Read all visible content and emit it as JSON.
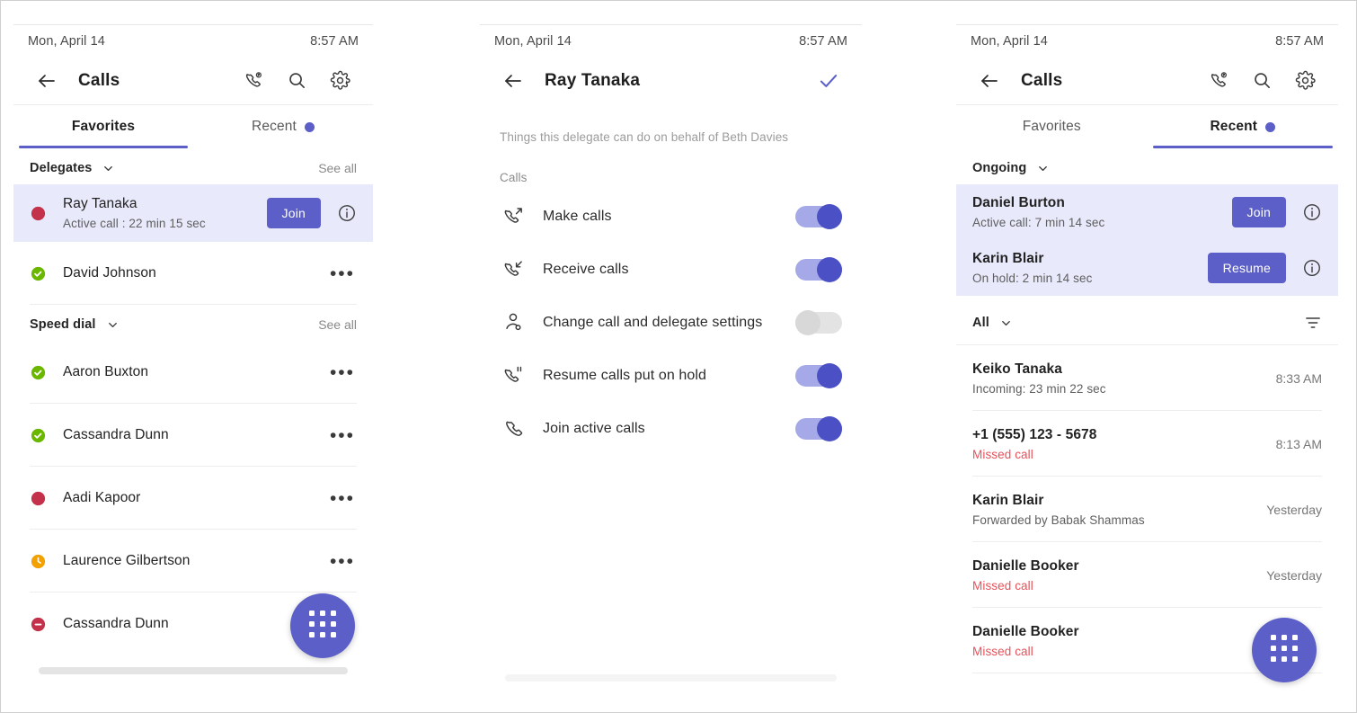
{
  "theme": {
    "accent": "#5b5fc7",
    "accent_dark": "#4b50c4",
    "missed_red": "#e8515a",
    "highlight_bg": "#e8eafc",
    "available_green": "#6bb700",
    "busy_red": "#c4314b",
    "away_orange": "#f2a101"
  },
  "panel1": {
    "status": {
      "date": "Mon, April 14",
      "time": "8:57 AM"
    },
    "appbar": {
      "title": "Calls",
      "back_icon": "arrow-left-icon",
      "actions": [
        "call-park-icon",
        "search-icon",
        "gear-icon"
      ]
    },
    "tabs": [
      {
        "label": "Favorites",
        "active": true,
        "dot": false
      },
      {
        "label": "Recent",
        "active": false,
        "dot": true
      }
    ],
    "sections": [
      {
        "label": "Delegates",
        "action": "See all",
        "rows": [
          {
            "name": "Ray Tanaka",
            "sub": "Active call : 22 min 15 sec",
            "presence": "busy",
            "highlight": true,
            "button": "Join",
            "info": true
          },
          {
            "name": "David Johnson",
            "sub": "",
            "presence": "available",
            "highlight": false,
            "more": true
          }
        ]
      },
      {
        "label": "Speed dial",
        "action": "See all",
        "rows": [
          {
            "name": "Aaron Buxton",
            "sub": "",
            "presence": "available",
            "more": true
          },
          {
            "name": "Cassandra Dunn",
            "sub": "",
            "presence": "available",
            "more": true
          },
          {
            "name": "Aadi Kapoor",
            "sub": "",
            "presence": "busy",
            "more": true
          },
          {
            "name": "Laurence Gilbertson",
            "sub": "",
            "presence": "away",
            "more": true
          },
          {
            "name": "Cassandra Dunn",
            "sub": "",
            "presence": "dnd",
            "more": false
          }
        ]
      }
    ],
    "fab": "dialpad-icon"
  },
  "panel2": {
    "status": {
      "date": "Mon, April 14",
      "time": "8:57 AM"
    },
    "appbar": {
      "title": "Ray Tanaka",
      "back_icon": "arrow-left-icon",
      "confirm_icon": "checkmark-icon"
    },
    "note": "Things this delegate can do on behalf of Beth Davies",
    "group_label": "Calls",
    "permissions": [
      {
        "icon": "call-outgoing-icon",
        "label": "Make calls",
        "on": true
      },
      {
        "icon": "call-incoming-icon",
        "label": "Receive calls",
        "on": true
      },
      {
        "icon": "person-settings-icon",
        "label": "Change call and delegate settings",
        "on": false
      },
      {
        "icon": "call-hold-icon",
        "label": "Resume calls put on hold",
        "on": true
      },
      {
        "icon": "call-icon",
        "label": "Join active calls",
        "on": true
      }
    ]
  },
  "panel3": {
    "status": {
      "date": "Mon, April 14",
      "time": "8:57 AM"
    },
    "appbar": {
      "title": "Calls",
      "back_icon": "arrow-left-icon",
      "actions": [
        "call-park-icon",
        "search-icon",
        "gear-icon"
      ]
    },
    "tabs": [
      {
        "label": "Favorites",
        "active": false,
        "dot": false
      },
      {
        "label": "Recent",
        "active": true,
        "dot": true
      }
    ],
    "ongoing": {
      "label": "Ongoing",
      "rows": [
        {
          "name": "Daniel Burton",
          "sub": "Active call: 7 min 14 sec",
          "button": "Join",
          "info": true
        },
        {
          "name": "Karin Blair",
          "sub": "On hold: 2 min 14 sec",
          "button": "Resume",
          "info": true
        }
      ]
    },
    "filterbar": {
      "label": "All",
      "filter_icon": "filter-icon"
    },
    "history": [
      {
        "name": "Keiko Tanaka",
        "sub": "Incoming: 23 min 22 sec",
        "missed": false,
        "time": "8:33 AM"
      },
      {
        "name": "+1 (555) 123 - 5678",
        "sub": "Missed call",
        "missed": true,
        "time": "8:13 AM"
      },
      {
        "name": "Karin Blair",
        "sub": "Forwarded by Babak Shammas",
        "missed": false,
        "time": "Yesterday"
      },
      {
        "name": "Danielle Booker",
        "sub": "Missed call",
        "missed": true,
        "time": "Yesterday"
      },
      {
        "name": "Danielle Booker",
        "sub": "Missed call",
        "missed": true,
        "time": ""
      }
    ],
    "fab": "dialpad-icon"
  }
}
